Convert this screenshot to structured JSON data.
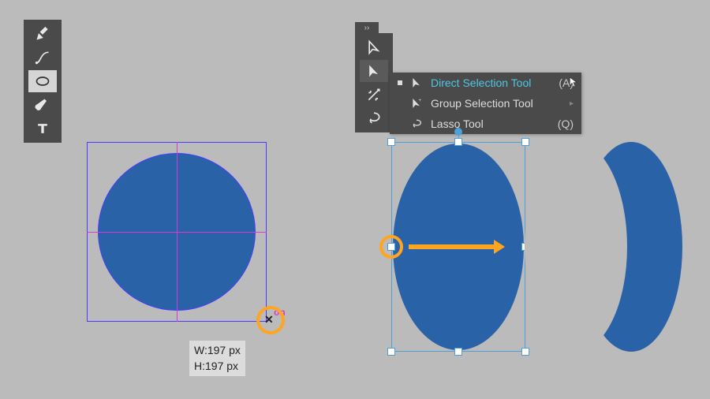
{
  "left_toolbar": {
    "tools": [
      {
        "name": "pen-icon"
      },
      {
        "name": "curvature-icon"
      },
      {
        "name": "ellipse-icon",
        "selected": true
      },
      {
        "name": "brush-icon"
      },
      {
        "name": "type-icon"
      }
    ]
  },
  "right_toolbar": {
    "tools": [
      {
        "name": "selection-icon"
      },
      {
        "name": "direct-selection-icon",
        "selected": true
      },
      {
        "name": "magic-wand-icon"
      },
      {
        "name": "lasso-icon"
      }
    ]
  },
  "flyout": {
    "items": [
      {
        "label": "Direct Selection Tool",
        "key": "(A)",
        "active": true,
        "icon": "direct-selection-icon"
      },
      {
        "label": "Group Selection Tool",
        "key": "",
        "active": false,
        "icon": "group-selection-icon"
      },
      {
        "label": "Lasso Tool",
        "key": "(Q)",
        "active": false,
        "icon": "lasso-icon"
      }
    ]
  },
  "circle": {
    "fill": "#2a62a8",
    "on_label": "on",
    "size_tip": {
      "w_label": "W:197 px",
      "h_label": "H:197 px"
    }
  },
  "colors": {
    "accent": "#ffa51f",
    "ring": "#ffa51f"
  }
}
